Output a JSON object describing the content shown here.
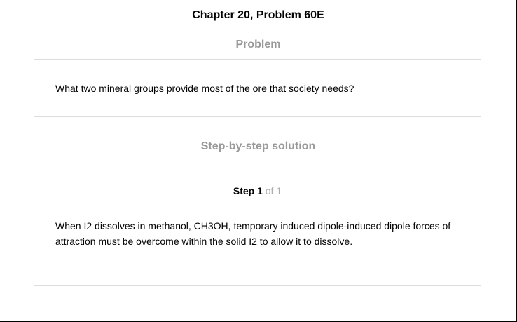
{
  "header": {
    "chapter_title": "Chapter 20, Problem 60E"
  },
  "problem": {
    "heading": "Problem",
    "text": "What two mineral groups provide most of the ore that society needs?"
  },
  "solution": {
    "heading": "Step-by-step solution",
    "step": {
      "label": "Step 1",
      "of_text": "of 1",
      "text": "When I2 dissolves in methanol, CH3OH, temporary induced dipole-induced dipole forces of attraction must be overcome within the solid I2 to allow it to dissolve."
    }
  }
}
